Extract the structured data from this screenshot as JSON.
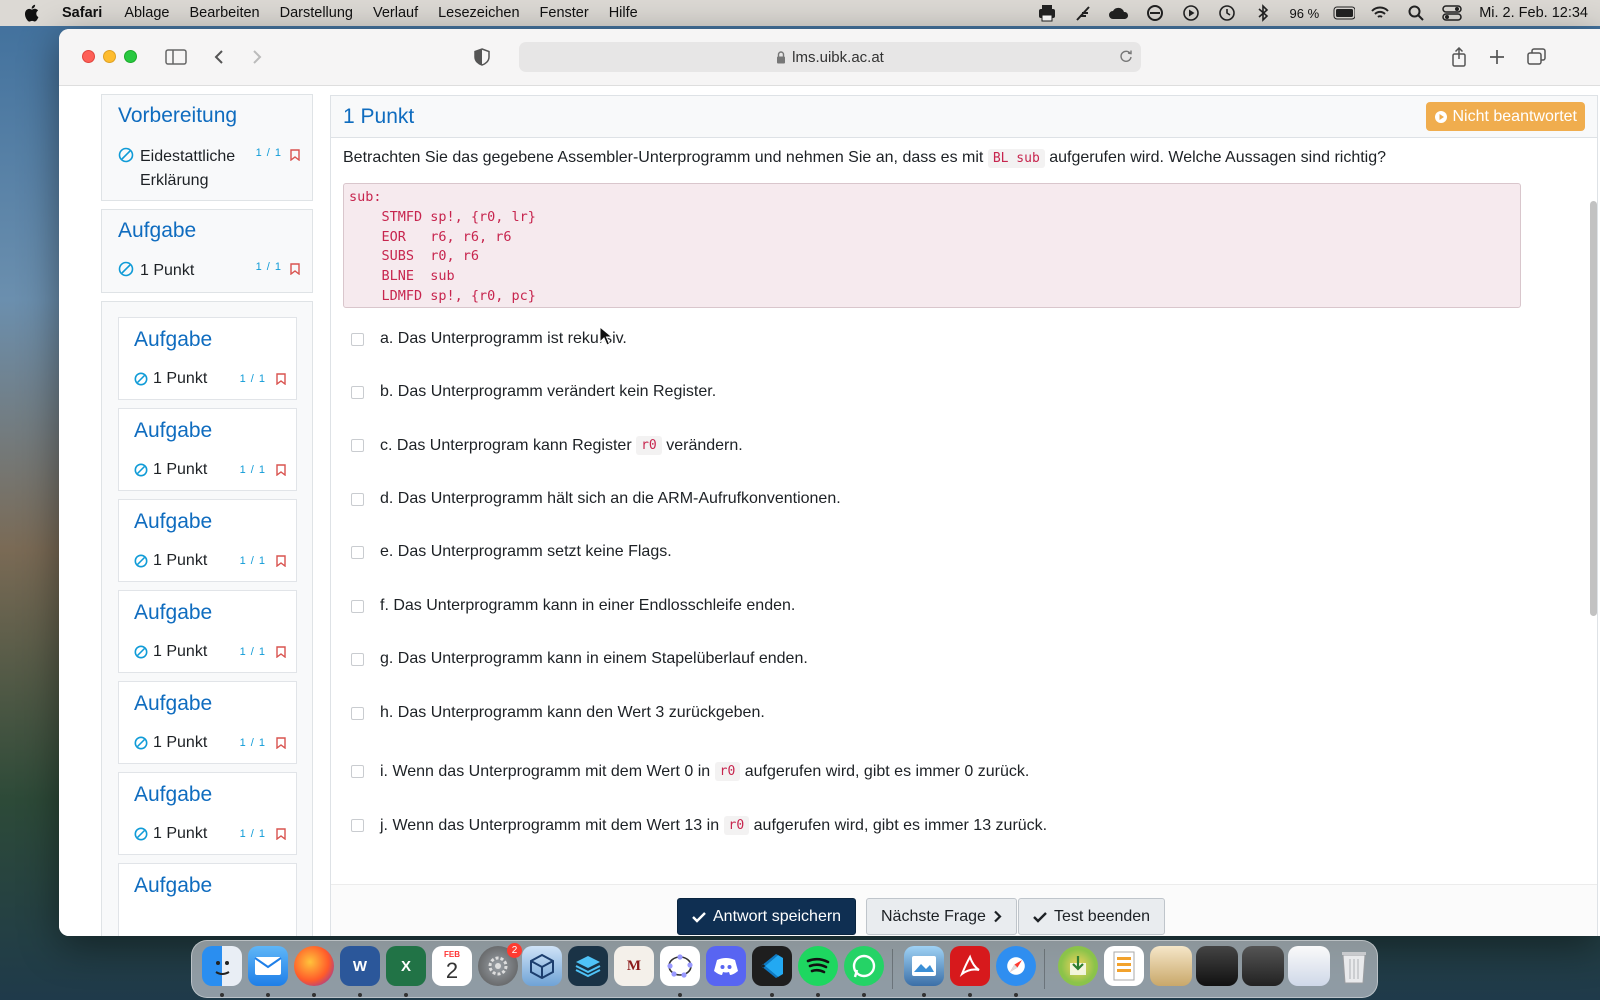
{
  "menubar": {
    "app_name": "Safari",
    "items": [
      "Ablage",
      "Bearbeiten",
      "Darstellung",
      "Verlauf",
      "Lesezeichen",
      "Fenster",
      "Hilfe"
    ],
    "battery": "96 %",
    "clock": "Mi. 2. Feb. 12:34"
  },
  "browser": {
    "url": "lms.uibk.ac.at"
  },
  "sidebar": {
    "section1": {
      "title": "Vorbereitung",
      "item_label": "Eidestattliche Erklärung",
      "mark": "1 / 1"
    },
    "section2": {
      "title": "Aufgabe",
      "item_label": "1 Punkt",
      "mark": "1 / 1"
    },
    "questions": [
      {
        "title": "Aufgabe",
        "label": "1 Punkt",
        "mark": "1 / 1"
      },
      {
        "title": "Aufgabe",
        "label": "1 Punkt",
        "mark": "1 / 1"
      },
      {
        "title": "Aufgabe",
        "label": "1 Punkt",
        "mark": "1 / 1"
      },
      {
        "title": "Aufgabe",
        "label": "1 Punkt",
        "mark": "1 / 1"
      },
      {
        "title": "Aufgabe",
        "label": "1 Punkt",
        "mark": "1 / 1"
      },
      {
        "title": "Aufgabe",
        "label": "1 Punkt",
        "mark": "1 / 1"
      },
      {
        "title": "Aufgabe"
      }
    ]
  },
  "question": {
    "title": "1 Punkt",
    "status": "Nicht beantwortet",
    "text_before": "Betrachten Sie das gegebene Assembler-Unterprogramm und nehmen Sie an, dass es mit",
    "inline_code": "BL sub",
    "text_after": "aufgerufen wird. Welche Aussagen sind richtig?",
    "code": "sub:\n    STMFD sp!, {r0, lr}\n    EOR   r6, r6, r6\n    SUBS  r0, r6\n    BLNE  sub\n    LDMFD sp!, {r0, pc}",
    "answers": {
      "a": "a. Das Unterprogramm ist rekursiv.",
      "b": "b. Das Unterprogramm verändert kein Register.",
      "c_pre": "c. Das Unterprogram kann Register",
      "c_code": "r0",
      "c_post": "verändern.",
      "d": "d. Das Unterprogramm hält sich an die ARM-Aufrufkonventionen.",
      "e": "e. Das Unterprogramm setzt keine Flags.",
      "f": "f. Das Unterprogramm kann in einer Endlosschleife enden.",
      "g": "g. Das Unterprogramm kann in einem Stapelüberlauf enden.",
      "h": "h. Das Unterprogramm kann den Wert 3 zurückgeben.",
      "i_pre": "i. Wenn das Unterprogramm mit dem Wert 0 in",
      "i_code": "r0",
      "i_post": "aufgerufen wird, gibt es immer 0 zurück.",
      "j_pre": "j. Wenn das Unterprogramm mit dem Wert 13 in",
      "j_code": "r0",
      "j_post": "aufgerufen wird, gibt es immer 13 zurück."
    }
  },
  "buttons": {
    "save": "Antwort speichern",
    "next": "Nächste Frage",
    "finish": "Test beenden"
  },
  "dock": {
    "calendar_month": "FEB",
    "calendar_day": "2",
    "settings_badge": "2"
  },
  "colors": {
    "link": "#0f6cbf",
    "badge": "#f0ad4e",
    "primary_button": "#0f2f52",
    "code_text": "#c7254e"
  }
}
